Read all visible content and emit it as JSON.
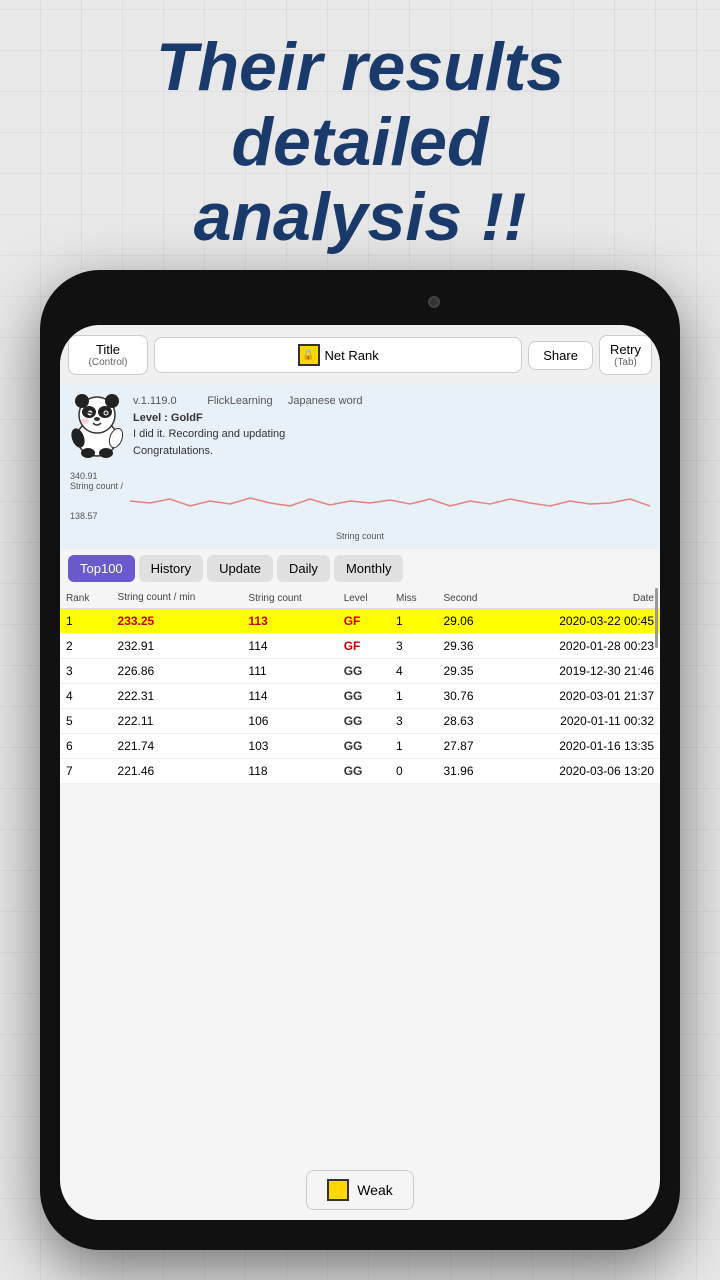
{
  "headline": {
    "line1": "Their results",
    "line2": "detailed",
    "line3": "analysis !!"
  },
  "toolbar": {
    "title_label": "Title",
    "title_sub": "(Control)",
    "netrank_label": "Net Rank",
    "share_label": "Share",
    "retry_label": "Retry",
    "retry_sub": "(Tab)"
  },
  "info": {
    "version": "v.1.119.0",
    "app_name": "FlickLearning",
    "level": "Level : GoldF",
    "congrats": "I did it. Recording and updating",
    "congrats2": "Congratulations.",
    "right_label": "Japanese word"
  },
  "chart": {
    "y_max": "340.91",
    "y_label": "String count /",
    "y_min": "138.57",
    "x_label": "String count"
  },
  "tabs": [
    {
      "id": "top100",
      "label": "Top100",
      "active": true
    },
    {
      "id": "history",
      "label": "History",
      "active": false
    },
    {
      "id": "update",
      "label": "Update",
      "active": false
    },
    {
      "id": "daily",
      "label": "Daily",
      "active": false
    },
    {
      "id": "monthly",
      "label": "Monthly",
      "active": false
    }
  ],
  "table": {
    "headers": {
      "rank": "Rank",
      "string_count_min": "String count / min",
      "string_count": "String count",
      "level": "Level",
      "miss": "Miss",
      "second": "Second",
      "date": "Date"
    },
    "rows": [
      {
        "rank": "1",
        "string_count_min": "233.25",
        "string_count": "113",
        "level": "GF",
        "miss": "1",
        "second": "29.06",
        "date": "2020-03-22 00:45",
        "highlight": true
      },
      {
        "rank": "2",
        "string_count_min": "232.91",
        "string_count": "114",
        "level": "GF",
        "miss": "3",
        "second": "29.36",
        "date": "2020-01-28 00:23",
        "highlight": false
      },
      {
        "rank": "3",
        "string_count_min": "226.86",
        "string_count": "111",
        "level": "GG",
        "miss": "4",
        "second": "29.35",
        "date": "2019-12-30 21:46",
        "highlight": false
      },
      {
        "rank": "4",
        "string_count_min": "222.31",
        "string_count": "114",
        "level": "GG",
        "miss": "1",
        "second": "30.76",
        "date": "2020-03-01 21:37",
        "highlight": false
      },
      {
        "rank": "5",
        "string_count_min": "222.11",
        "string_count": "106",
        "level": "GG",
        "miss": "3",
        "second": "28.63",
        "date": "2020-01-11 00:32",
        "highlight": false
      },
      {
        "rank": "6",
        "string_count_min": "221.74",
        "string_count": "103",
        "level": "GG",
        "miss": "1",
        "second": "27.87",
        "date": "2020-01-16 13:35",
        "highlight": false
      },
      {
        "rank": "7",
        "string_count_min": "221.46",
        "string_count": "118",
        "level": "GG",
        "miss": "0",
        "second": "31.96",
        "date": "2020-03-06 13:20",
        "highlight": false
      }
    ]
  },
  "weak_button": {
    "label": "Weak"
  },
  "colors": {
    "headline": "#1a3a6b",
    "tab_active": "#6a5acd",
    "highlight_row": "#ffff00",
    "gf_color": "#cc0000"
  }
}
